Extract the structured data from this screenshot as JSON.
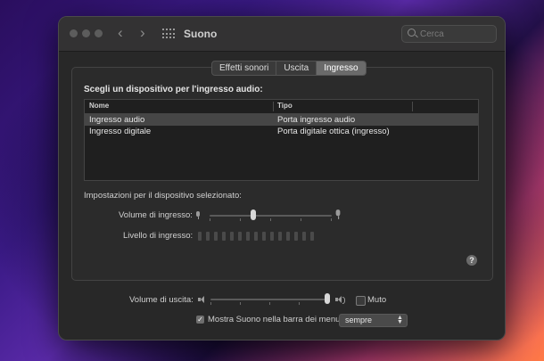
{
  "window": {
    "title": "Suono"
  },
  "search": {
    "placeholder": "Cerca"
  },
  "tabs": [
    {
      "label": "Effetti sonori",
      "active": false
    },
    {
      "label": "Uscita",
      "active": false
    },
    {
      "label": "Ingresso",
      "active": true
    }
  ],
  "input": {
    "section_title": "Scegli un dispositivo per l'ingresso audio:",
    "columns": {
      "name": "Nome",
      "type": "Tipo"
    },
    "rows": [
      {
        "name": "Ingresso audio",
        "type": "Porta ingresso audio",
        "selected": true
      },
      {
        "name": "Ingresso digitale",
        "type": "Porta digitale ottica (ingresso)",
        "selected": false
      }
    ],
    "settings_label": "Impostazioni per il dispositivo selezionato:",
    "volume_label": "Volume di ingresso:",
    "volume_level": 0.36,
    "level_label": "Livello di ingresso:",
    "level_bar_count": 15
  },
  "help": {
    "label": "?"
  },
  "output": {
    "volume_label": "Volume di uscita:",
    "volume_level": 1.0,
    "mute_label": "Muto",
    "mute_checked": false
  },
  "menubar": {
    "label": "Mostra Suono nella barra dei menu",
    "checked": true,
    "option": "sempre"
  },
  "colors": {
    "window_bg": "#282828",
    "selected_row": "#464646"
  }
}
